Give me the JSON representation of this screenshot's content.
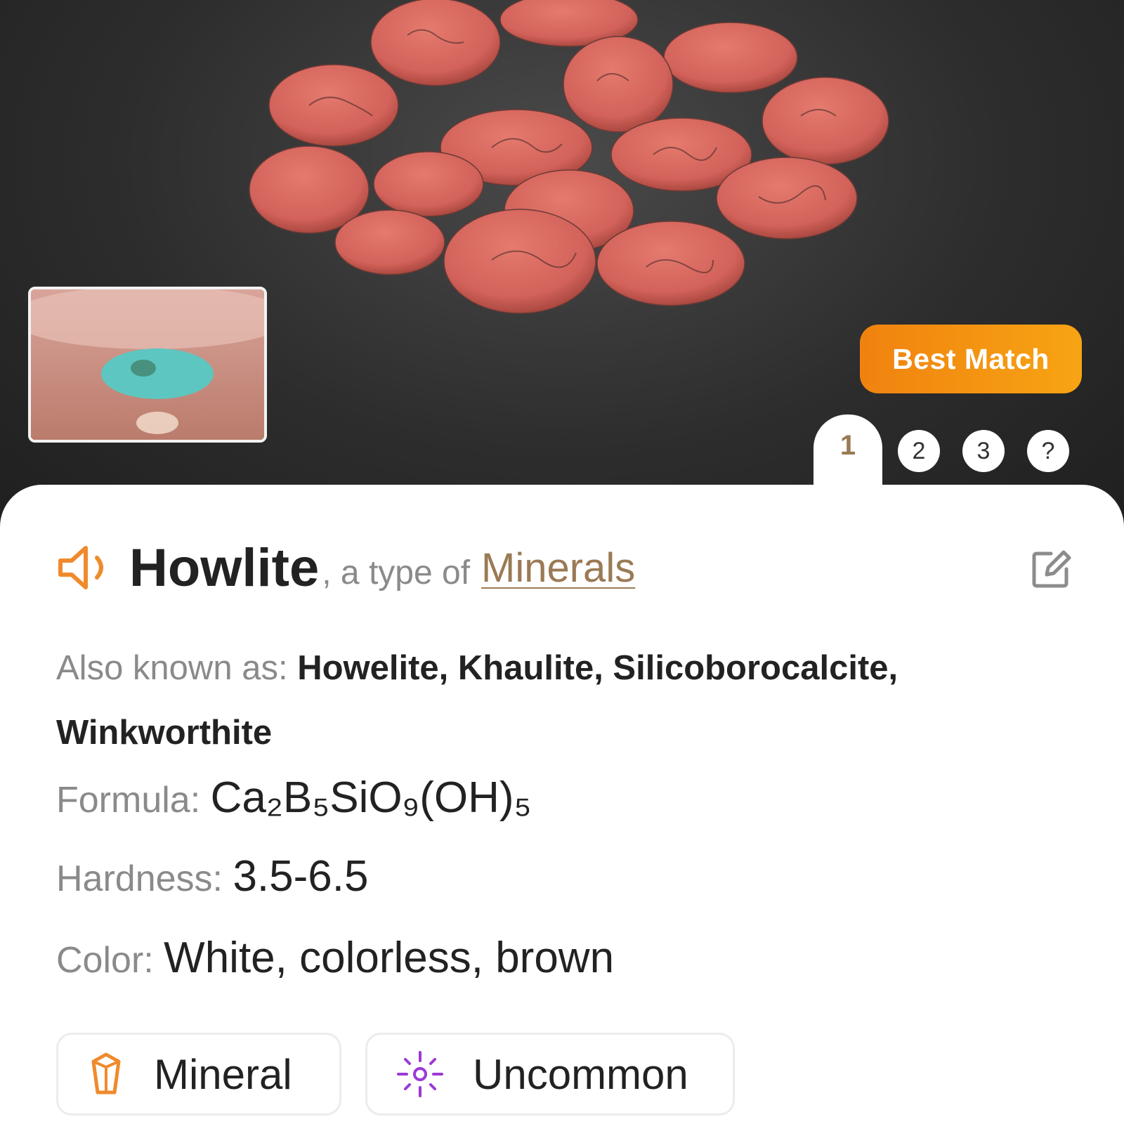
{
  "hero": {
    "badge": "Best Match",
    "tabs": [
      "1",
      "2",
      "3",
      "?"
    ],
    "active_tab": "1"
  },
  "result": {
    "name": "Howlite",
    "type_prefix": ", a type of",
    "category": "Minerals"
  },
  "details": {
    "aka_label": "Also known as:",
    "aka_value": "Howelite, Khaulite, Silicoborocalcite, Winkworthite",
    "formula_label": "Formula:",
    "formula_value": "Ca₂B₅SiO₉(OH)₅",
    "hardness_label": "Hardness:",
    "hardness_value": "3.5-6.5",
    "color_label": "Color:",
    "color_value": "White, colorless, brown"
  },
  "tags": [
    {
      "label": "Mineral",
      "icon": "crystal-icon"
    },
    {
      "label": "Uncommon",
      "icon": "sparkle-icon"
    }
  ],
  "colors": {
    "accent": "#9a7a55",
    "badge_start": "#f0820f",
    "badge_end": "#f7a413",
    "speaker": "#f08a2c",
    "uncommon": "#9b3ad6"
  }
}
